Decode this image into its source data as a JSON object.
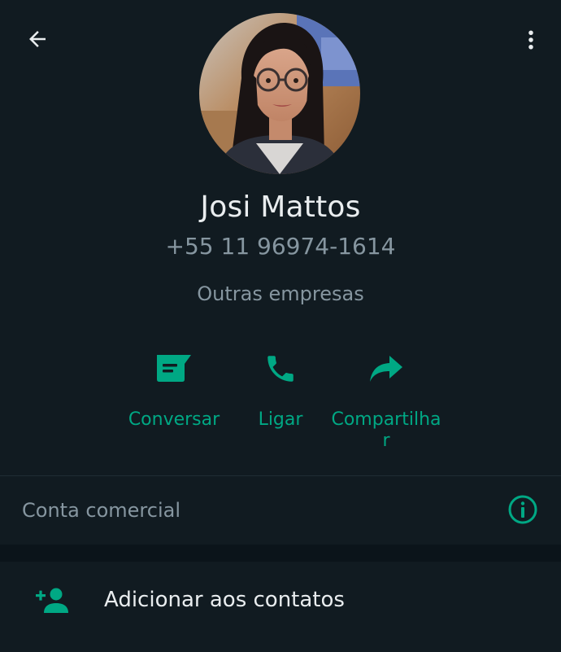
{
  "contact": {
    "name": "Josi Mattos",
    "phone": "+55 11 96974-1614",
    "category": "Outras empresas"
  },
  "actions": [
    {
      "label": "Conversar",
      "icon": "message-icon"
    },
    {
      "label": "Ligar",
      "icon": "phone-icon"
    },
    {
      "label": "Compartilhar",
      "icon": "share-icon"
    }
  ],
  "business": {
    "label": "Conta comercial",
    "icon": "info-icon"
  },
  "add_contact": {
    "label": "Adicionar aos contatos",
    "icon": "add-contact-icon"
  },
  "colors": {
    "background": "#111b21",
    "accent": "#00a884",
    "primary_text": "#e9edef",
    "secondary_text": "#8696a0",
    "separator": "#0b141a"
  }
}
